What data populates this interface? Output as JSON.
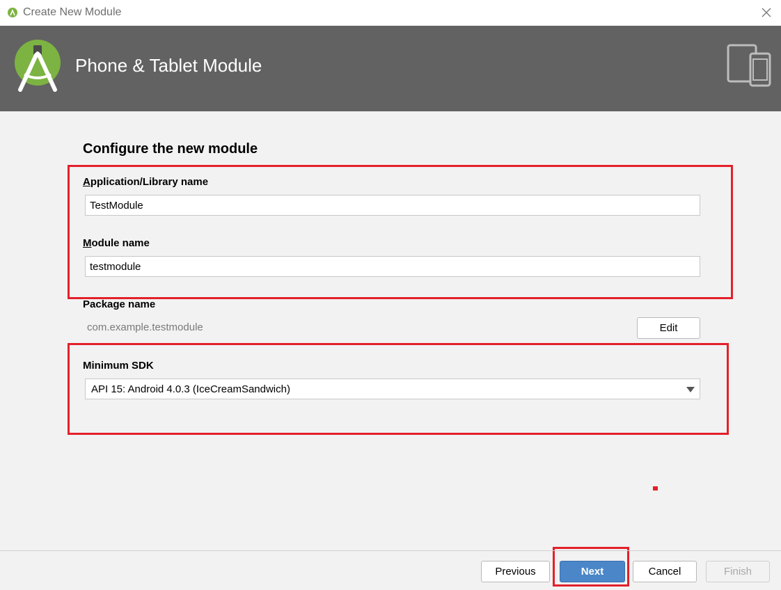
{
  "window": {
    "title": "Create New Module"
  },
  "banner": {
    "title": "Phone & Tablet Module"
  },
  "form": {
    "heading": "Configure the new module",
    "app_name": {
      "label_mnemonic": "A",
      "label_rest": "pplication/Library name",
      "value": "TestModule"
    },
    "module_name": {
      "label_mnemonic": "M",
      "label_rest": "odule name",
      "value": "testmodule"
    },
    "package_name": {
      "label": "Package name",
      "value": "com.example.testmodule",
      "edit_label": "Edit"
    },
    "min_sdk": {
      "label": "Minimum SDK",
      "selected": "API 15: Android 4.0.3 (IceCreamSandwich)"
    }
  },
  "footer": {
    "previous_label": "Previous",
    "next_label": "Next",
    "cancel_label": "Cancel",
    "finish_label": "Finish"
  },
  "colors": {
    "banner": "#626262",
    "accent_primary": "#4a86c8",
    "highlight": "#e3202a",
    "android_green": "#7cb342"
  }
}
